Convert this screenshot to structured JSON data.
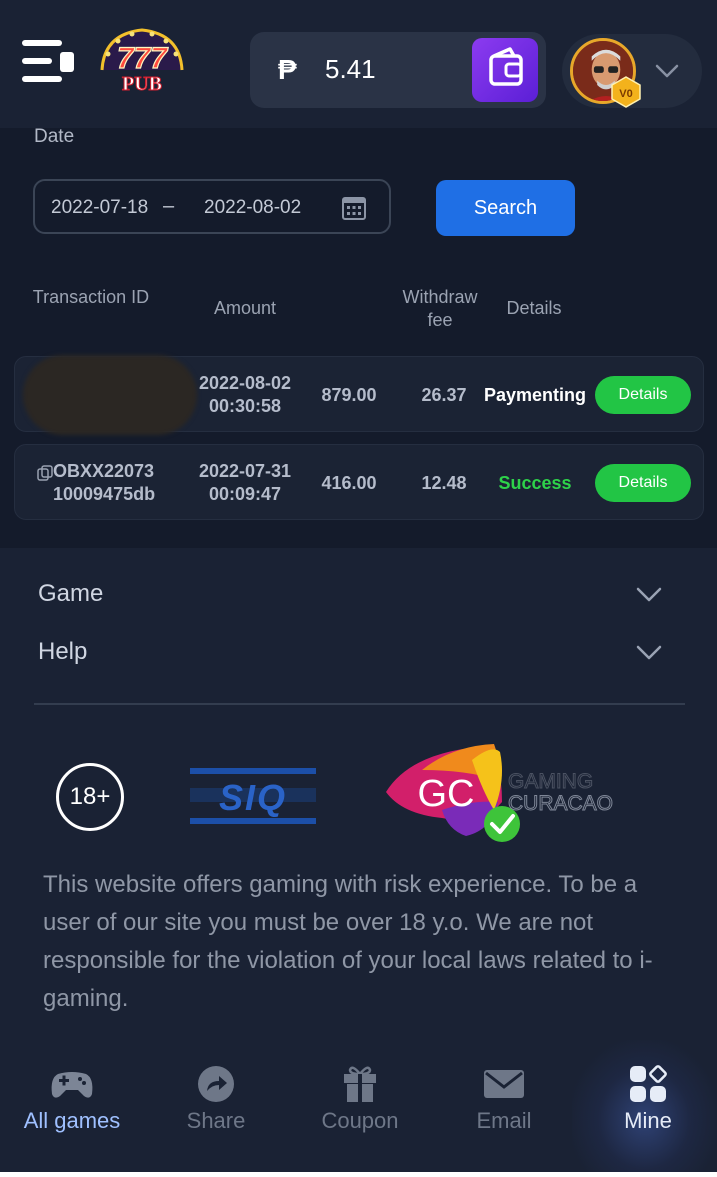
{
  "header": {
    "logo_text_top": "777",
    "logo_text_bottom": "PUB",
    "currency_symbol": "₱",
    "balance": "5.41",
    "vip_level": "V0"
  },
  "filter": {
    "date_label": "Date",
    "date_from": "2022-07-18",
    "date_separator": "–",
    "date_to": "2022-08-02",
    "search_label": "Search"
  },
  "table": {
    "headers": {
      "transaction_id": "Transaction ID",
      "amount": "Amount",
      "withdraw_fee": "Withdraw fee",
      "details": "Details"
    },
    "rows": [
      {
        "id": "",
        "date": "2022-08-02",
        "time": "00:30:58",
        "amount": "879.00",
        "fee": "26.37",
        "status": "Paymenting",
        "button": "Details"
      },
      {
        "id_line1": "OBXX22073",
        "id_line2": "10009475db",
        "date": "2022-07-31",
        "time": "00:09:47",
        "amount": "416.00",
        "fee": "12.48",
        "status": "Success",
        "button": "Details"
      }
    ]
  },
  "footer": {
    "accordion": [
      "Game",
      "Help"
    ],
    "age_badge": "18+",
    "sig_text": "SIQ",
    "gc_text": "GC",
    "gc_line1": "GAMING",
    "gc_line2": "CURACAO",
    "disclaimer": "This website offers gaming with risk experience. To be a user of our site you must be over 18 y.o. We are not responsible for the violation of your local laws related to i-gaming."
  },
  "nav": {
    "items": [
      {
        "label": "All games",
        "icon": "gamepad-icon"
      },
      {
        "label": "Share",
        "icon": "share-icon"
      },
      {
        "label": "Coupon",
        "icon": "gift-icon"
      },
      {
        "label": "Email",
        "icon": "mail-icon"
      },
      {
        "label": "Mine",
        "icon": "grid-icon"
      }
    ],
    "active": "Mine"
  },
  "colors": {
    "background": "#141b2b",
    "header": "#1a2234",
    "search_blue": "#1f6fe5",
    "details_green": "#22c545",
    "success_green": "#2ed24a",
    "wallet_purple": "#7a2de8"
  }
}
